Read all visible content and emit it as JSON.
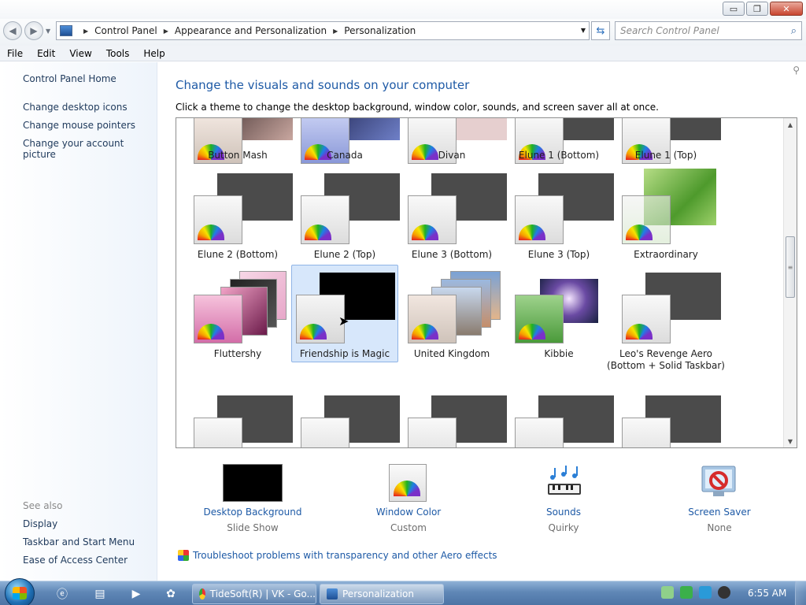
{
  "window": {
    "minimize": "▭",
    "maximize": "❐",
    "close": "✕"
  },
  "address": {
    "crumbs": [
      "Control Panel",
      "Appearance and Personalization",
      "Personalization"
    ],
    "search_placeholder": "Search Control Panel"
  },
  "menu": [
    "File",
    "Edit",
    "View",
    "Tools",
    "Help"
  ],
  "sidebar": {
    "home": "Control Panel Home",
    "links": [
      "Change desktop icons",
      "Change mouse pointers",
      "Change your account picture"
    ],
    "see_also_label": "See also",
    "see_also": [
      "Display",
      "Taskbar and Start Menu",
      "Ease of Access Center"
    ]
  },
  "main": {
    "heading": "Change the visuals and sounds on your computer",
    "subtext": "Click a theme to change the desktop background, window color, sounds, and screen saver all at once."
  },
  "themes": {
    "row1": [
      "Button Mash",
      "Canada",
      "Divan",
      "Elune 1 (Bottom)",
      "Elune 1 (Top)"
    ],
    "row2": [
      "Elune 2 (Bottom)",
      "Elune 2 (Top)",
      "Elune 3 (Bottom)",
      "Elune 3 (Top)",
      "Extraordinary"
    ],
    "row3": [
      "Fluttershy",
      "Friendship is Magic",
      "United Kingdom",
      "Kibbie",
      "Leo's Revenge Aero (Bottom + Solid Taskbar)"
    ],
    "selected": "Friendship is Magic"
  },
  "bottom": {
    "desktop_background": {
      "label": "Desktop Background",
      "value": "Slide Show"
    },
    "window_color": {
      "label": "Window Color",
      "value": "Custom"
    },
    "sounds": {
      "label": "Sounds",
      "value": "Quirky"
    },
    "screen_saver": {
      "label": "Screen Saver",
      "value": "None"
    },
    "troubleshoot": "Troubleshoot problems with transparency and other Aero effects"
  },
  "taskbar": {
    "tasks": [
      "TideSoft(R) | VK - Go...",
      "Personalization"
    ],
    "clock": "6:55 AM"
  },
  "colors": {
    "link": "#1e5aa6",
    "selection": "#d7e7fb",
    "taskbar": "#5f87b6"
  }
}
